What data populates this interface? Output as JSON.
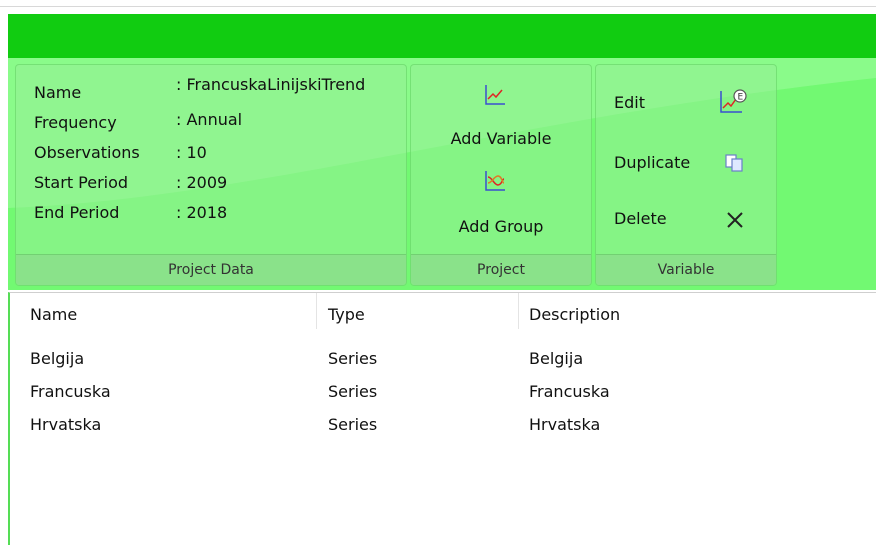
{
  "project_data": {
    "fields": [
      {
        "label": "Name",
        "value": ": FrancuskaLinijskiTrend"
      },
      {
        "label": "Frequency",
        "value": ": Annual"
      },
      {
        "label": "Observations",
        "value": ": 10"
      },
      {
        "label": "Start Period",
        "value": ": 2009"
      },
      {
        "label": "End Period",
        "value": ": 2018"
      }
    ],
    "footer": "Project Data"
  },
  "project_group": {
    "add_variable": "Add Variable",
    "add_group": "Add Group",
    "footer": "Project",
    "icons": [
      "line-chart-icon",
      "multi-line-chart-icon"
    ]
  },
  "variable_group": {
    "edit": "Edit",
    "duplicate": "Duplicate",
    "delete": "Delete",
    "footer": "Variable",
    "icons": [
      "edit-chart-icon",
      "duplicate-icon",
      "delete-x-icon"
    ]
  },
  "table": {
    "headers": [
      "Name",
      "Type",
      "Description"
    ],
    "rows": [
      [
        "Belgija",
        "Series",
        "Belgija"
      ],
      [
        "Francuska",
        "Series",
        "Francuska"
      ],
      [
        "Hrvatska",
        "Series",
        "Hrvatska"
      ]
    ]
  },
  "colors": {
    "title_bar": "#11cc11",
    "ribbon": "#66ff66",
    "group_footer": "#8ae28a",
    "list_border": "#55dd55"
  }
}
